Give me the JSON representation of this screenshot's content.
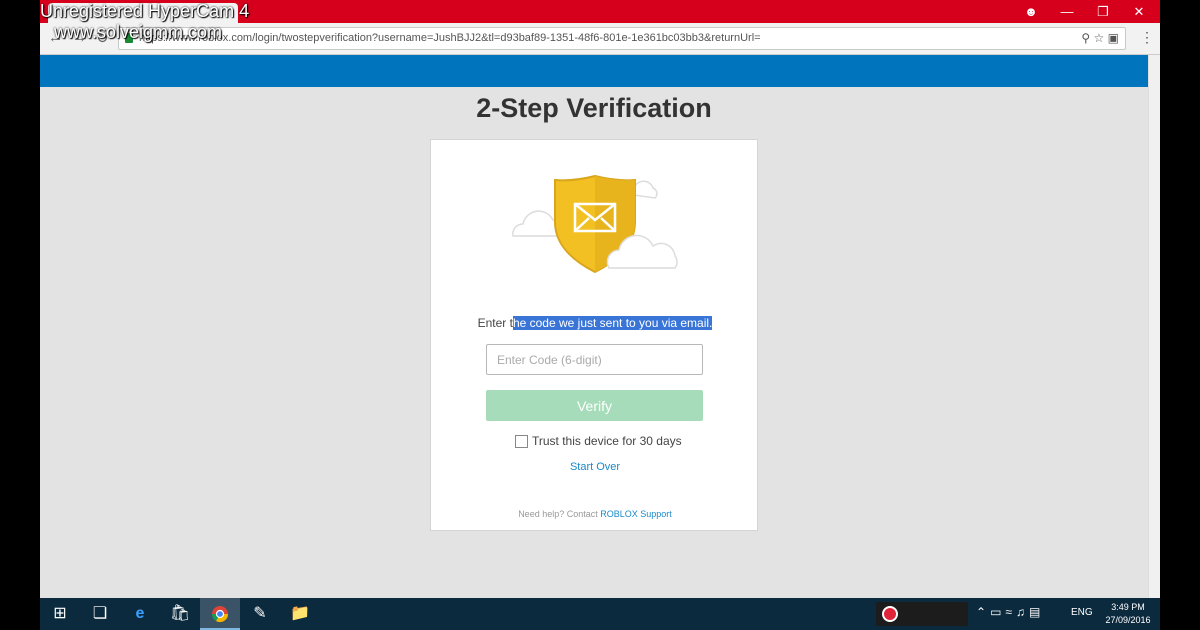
{
  "watermark": {
    "line1": "Unregistered HyperCam 4",
    "line2": "www.solveigmm.com"
  },
  "browser": {
    "url": "https://www.roblox.com/login/twostepverification?username=JushBJJ2&tl=d93baf89-1351-48f6-801e-1e361bc03bb3&returnUrl=",
    "controls": {
      "user": "user-icon",
      "minimize": "minimize-icon",
      "maximize": "restore-icon",
      "close": "close-icon"
    }
  },
  "page": {
    "title": "2-Step Verification",
    "prompt_before": "Enter t",
    "prompt_selected": "he code we just sent to you via email.",
    "code_placeholder": "Enter Code (6-digit)",
    "verify_label": "Verify",
    "trust_label": "Trust this device for 30 days",
    "start_over": "Start Over",
    "help_text": "Need help? Contact ",
    "help_link": "ROBLOX Support"
  },
  "colors": {
    "title_bar": "#d6001c",
    "site_header": "#0074bd",
    "verify_button": "#a6dcb9",
    "link": "#1a8ac8",
    "shield": "#f2c022",
    "taskbar": "#0c2a3e"
  },
  "taskbar": {
    "apps": [
      "start-icon",
      "task-view-icon",
      "edge-icon",
      "store-icon",
      "chrome-icon",
      "notepad-icon",
      "file-explorer-icon"
    ],
    "language": "ENG",
    "time": "3:49 PM",
    "date": "27/09/2016"
  }
}
